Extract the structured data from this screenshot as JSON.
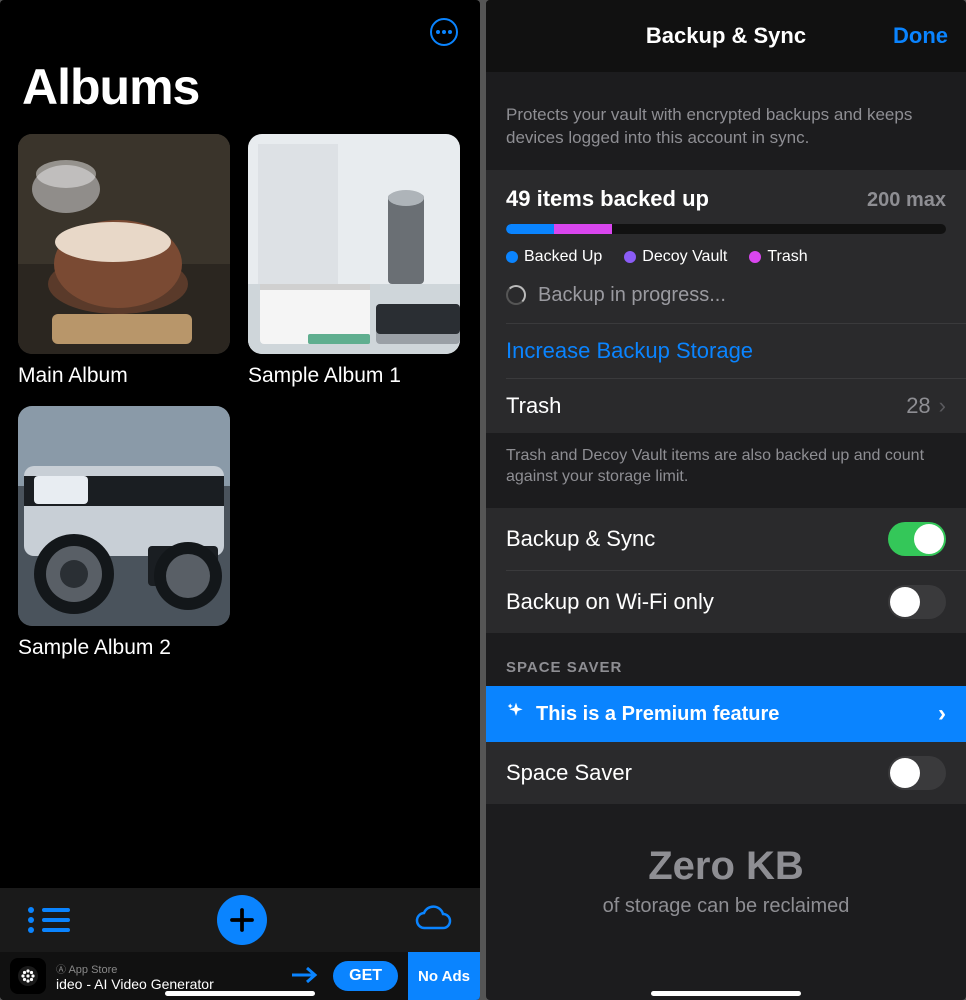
{
  "left": {
    "title": "Albums",
    "albums": [
      {
        "name": "Main Album"
      },
      {
        "name": "Sample Album 1"
      },
      {
        "name": "Sample Album 2"
      }
    ],
    "ad": {
      "store_label": "App Store",
      "title": "ideo - AI Video Generator",
      "get_label": "GET",
      "noads_label": "No Ads"
    }
  },
  "right": {
    "header_title": "Backup & Sync",
    "done_label": "Done",
    "desc": "Protects your vault with encrypted backups and keeps  devices logged into this account in sync.",
    "count_label": "49 items backed up",
    "max_label": "200 max",
    "bar": {
      "seg1_pct": 11,
      "seg2_pct": 13
    },
    "legend": {
      "l1": "Backed Up",
      "l2": "Decoy Vault",
      "l3": "Trash"
    },
    "progress_label": "Backup in progress...",
    "increase_label": "Increase Backup Storage",
    "trash_row": {
      "label": "Trash",
      "value": "28"
    },
    "trash_note": "Trash and Decoy Vault items are also backed up and count against your storage limit.",
    "sync_toggle_label": "Backup & Sync",
    "wifi_toggle_label": "Backup on Wi-Fi only",
    "space_section": "SPACE SAVER",
    "premium_label": "This is a Premium feature",
    "space_saver_label": "Space Saver",
    "zero_big": "Zero KB",
    "zero_sm": "of storage can be reclaimed"
  }
}
